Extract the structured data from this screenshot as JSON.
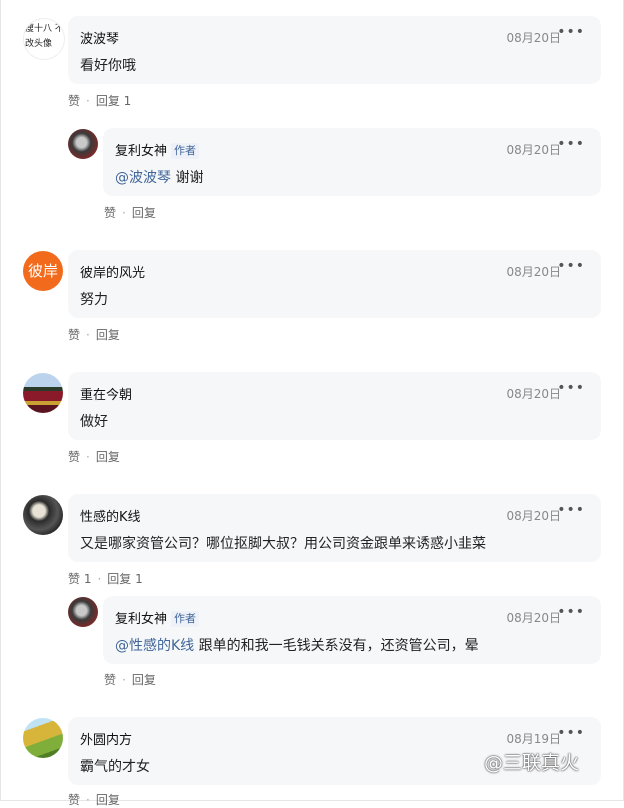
{
  "comments": [
    {
      "name": "波波琴",
      "date": "08月20日",
      "text": "看好你哦",
      "like": "赞",
      "reply": "回复 1",
      "avatar_label": "瘦十八 不改头像",
      "more": "•••"
    },
    {
      "name": "复利女神",
      "tag": "作者",
      "date": "08月20日",
      "mention": "@波波琴",
      "text": " 谢谢",
      "like": "赞",
      "reply": "回复",
      "more": "•••"
    },
    {
      "name": "彼岸的风光",
      "date": "08月20日",
      "text": "努力",
      "like": "赞",
      "reply": "回复",
      "avatar_label": "彼岸",
      "more": "•••"
    },
    {
      "name": "重在今朝",
      "date": "08月20日",
      "text": "做好",
      "like": "赞",
      "reply": "回复",
      "more": "•••"
    },
    {
      "name": "性感的K线",
      "date": "08月20日",
      "text": "又是哪家资管公司？哪位抠脚大叔？用公司资金跟单来诱惑小韭菜",
      "like": "赞 1",
      "reply": "回复 1",
      "more": "•••"
    },
    {
      "name": "复利女神",
      "tag": "作者",
      "date": "08月20日",
      "mention": "@性感的K线",
      "text": " 跟单的和我一毛钱关系没有，还资管公司，晕",
      "like": "赞",
      "reply": "回复",
      "more": "•••"
    },
    {
      "name": "外圆内方",
      "date": "08月19日",
      "text": "霸气的才女",
      "like": "赞",
      "reply": "回复",
      "more": "•••"
    }
  ],
  "watermark": "@三联真火",
  "colors": {
    "bubble": "#f6f7f9",
    "mention": "#406599",
    "date": "#888888"
  }
}
